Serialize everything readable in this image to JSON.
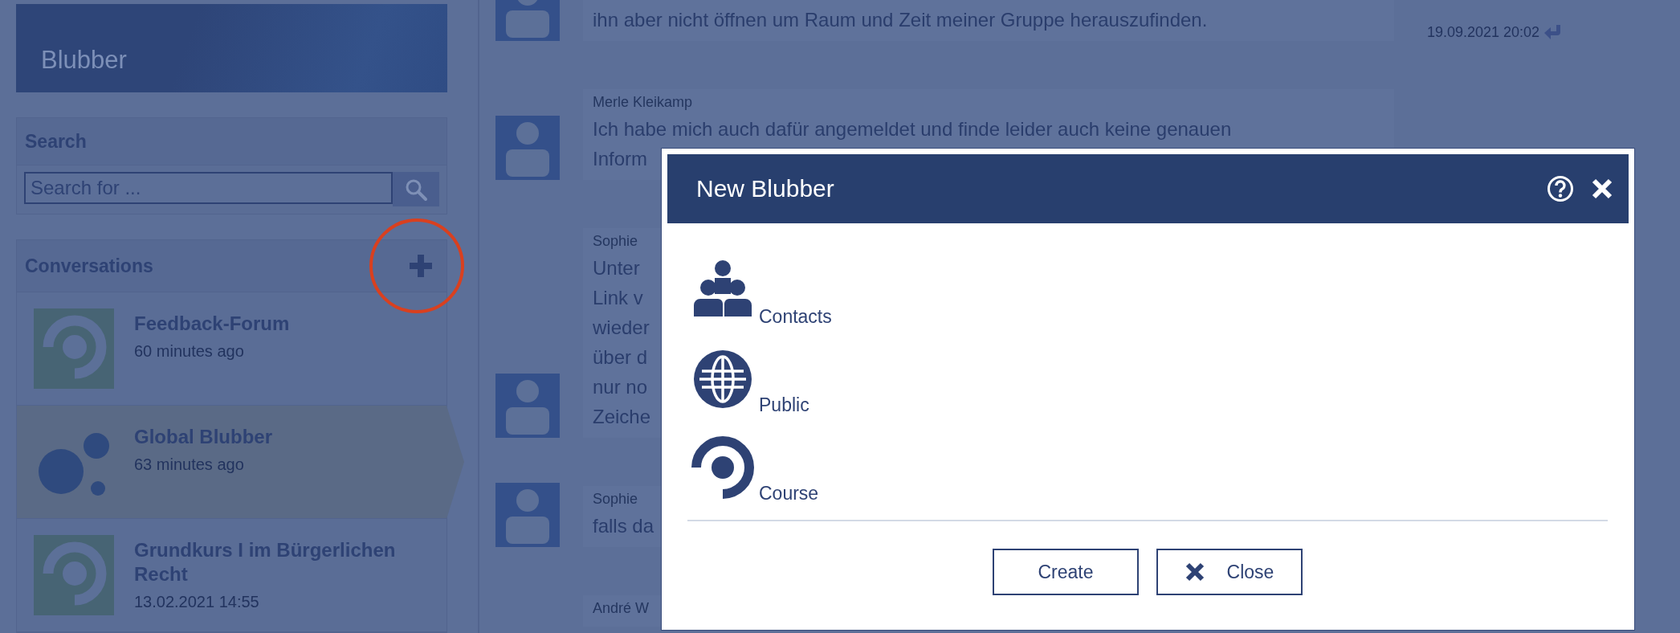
{
  "sidebar": {
    "title": "Blubber",
    "search": {
      "heading": "Search",
      "placeholder": "Search for ..."
    },
    "conversations": {
      "heading": "Conversations",
      "items": [
        {
          "kind": "course",
          "title": "Feedback-Forum",
          "time": "60 minutes ago",
          "selected": false
        },
        {
          "kind": "global",
          "title": "Global Blubber",
          "time": "63 minutes ago",
          "selected": true
        },
        {
          "kind": "course",
          "title": "Grundkurs I im Bürgerlichen Recht",
          "time": "13.02.2021 14:55",
          "selected": false
        }
      ]
    }
  },
  "messages": [
    {
      "lines": [
        "ihn aber nicht öffnen um Raum und Zeit meiner Gruppe herauszufinden."
      ],
      "time": "19.09.2021 20:02"
    },
    {
      "author": "Merle Kleikamp",
      "lines": [
        "Ich habe mich auch dafür angemeldet und finde leider auch keine genauen",
        "Inform"
      ]
    },
    {
      "author": "Sophie",
      "lines": [
        "Unter",
        "Link v",
        "wieder",
        "über d",
        "nur no",
        "Zeiche"
      ]
    },
    {
      "author": "Sophie",
      "lines": [
        "falls da"
      ]
    },
    {
      "author": "André W"
    }
  ],
  "dialog": {
    "title": "New Blubber",
    "options": [
      {
        "kind": "contacts",
        "label": "Contacts"
      },
      {
        "kind": "public",
        "label": "Public"
      },
      {
        "kind": "course",
        "label": "Course"
      }
    ],
    "buttons": [
      {
        "kind": "create",
        "label": "Create"
      },
      {
        "kind": "close",
        "label": "Close"
      }
    ]
  }
}
